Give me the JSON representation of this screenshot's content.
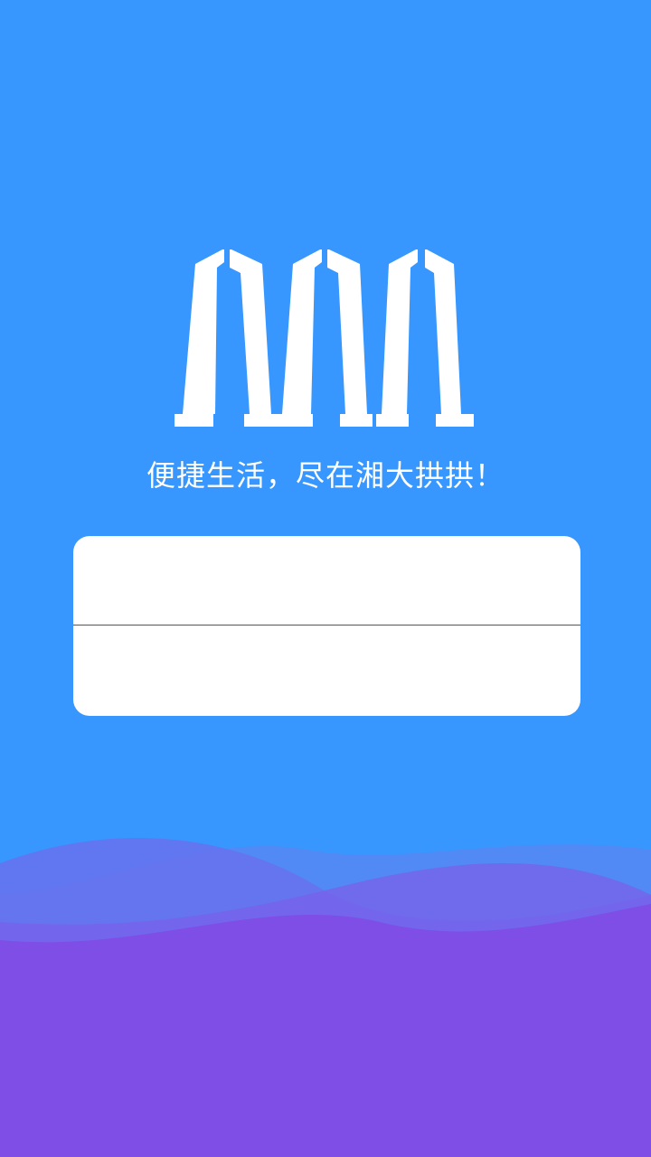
{
  "app": {
    "logo_icon": "xtu-arch-logo-icon",
    "slogan": "便捷生活，尽在湘大拱拱！"
  },
  "login": {
    "username_value": "",
    "username_placeholder": "",
    "password_value": "",
    "password_placeholder": ""
  },
  "colors": {
    "background": "#3797FE",
    "wave_bottom": "#7F4EE6",
    "card": "#FFFFFF"
  }
}
